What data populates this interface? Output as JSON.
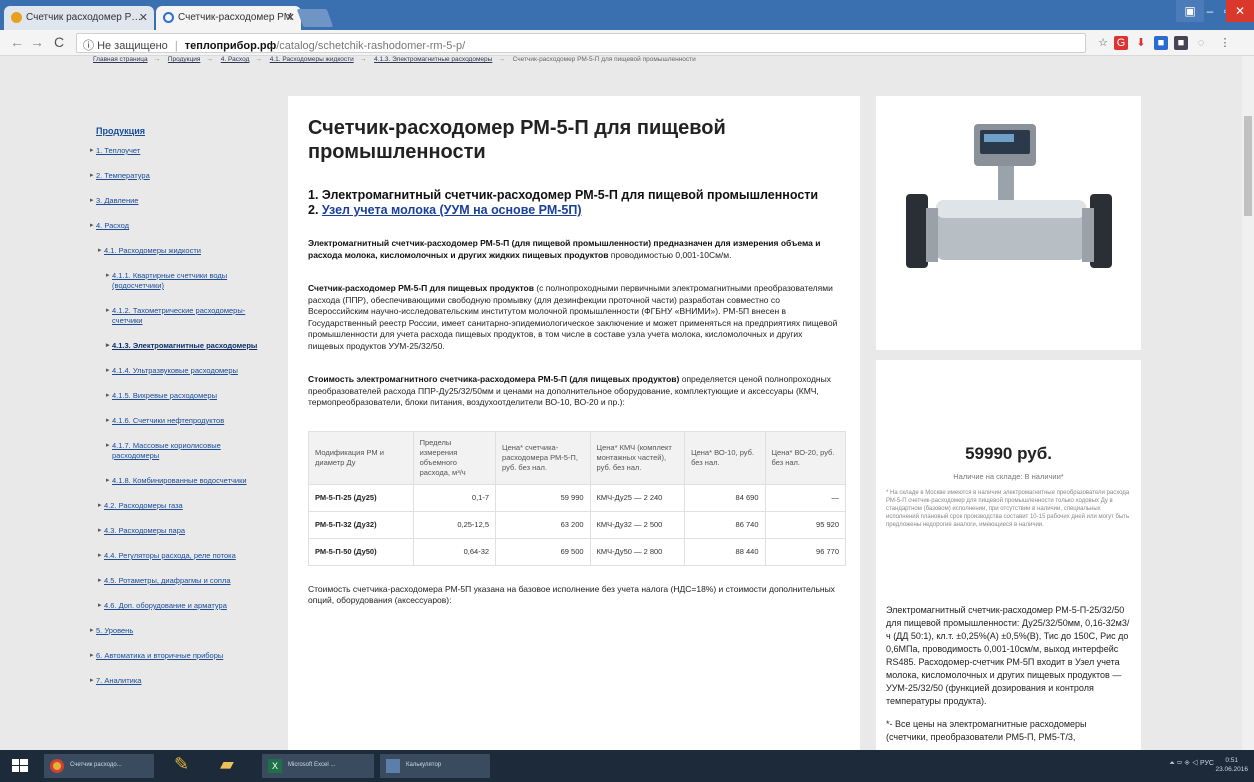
{
  "browser": {
    "tabs": [
      {
        "title": "Счетчик расходомер Р…",
        "active": false
      },
      {
        "title": "Счетчик-расходомер РМ",
        "active": true
      }
    ],
    "address": {
      "secure_label": "Не защищено",
      "host": "теплоприбор.рф",
      "path": "/catalog/schetchik-rashodomer-rm-5-p/"
    }
  },
  "breadcrumb": [
    "Главная страница",
    "Продукция",
    "4. Расход",
    "4.1. Расходомеры жидкости",
    "4.1.3. Электромагнитные расходомеры",
    "Счетчик-расходомер РМ-5-П для пищевой промышленности"
  ],
  "sidebar": {
    "heading": "Продукция",
    "items": [
      {
        "label": "1. Теплоучет",
        "level": 1
      },
      {
        "label": "2. Температура",
        "level": 1
      },
      {
        "label": "3. Давление",
        "level": 1
      },
      {
        "label": "4. Расход",
        "level": 1
      },
      {
        "label": "4.1. Расходомеры жидкости",
        "level": 2
      },
      {
        "label": "4.1.1. Квартирные счетчики воды (водосчетчики)",
        "level": 3
      },
      {
        "label": "4.1.2. Тахометрические расходомеры-счетчики",
        "level": 3
      },
      {
        "label": "4.1.3. Электромагнитные расходомеры",
        "level": 3,
        "active": true
      },
      {
        "label": "4.1.4. Ультразвуковые расходомеры",
        "level": 3
      },
      {
        "label": "4.1.5. Вихревые расходомеры",
        "level": 3
      },
      {
        "label": "4.1.6. Счетчики нефтепродуктов",
        "level": 3
      },
      {
        "label": "4.1.7. Массовые кориолисовые расходомеры",
        "level": 3
      },
      {
        "label": "4.1.8. Комбинированные водосчетчики",
        "level": 3
      },
      {
        "label": "4.2. Расходомеры газа",
        "level": 2
      },
      {
        "label": "4.3. Расходомеры пара",
        "level": 2
      },
      {
        "label": "4.4. Регуляторы расхода, реле потока",
        "level": 2
      },
      {
        "label": "4.5. Ротаметры, диафрагмы и сопла",
        "level": 2
      },
      {
        "label": "4.6. Доп. оборудование и арматура",
        "level": 2
      },
      {
        "label": "5. Уровень",
        "level": 1
      },
      {
        "label": "6. Автоматика и вторичные приборы",
        "level": 1
      },
      {
        "label": "7. Аналитика",
        "level": 1
      }
    ]
  },
  "main": {
    "title": "Счетчик-расходомер РМ-5-П для пищевой промышленности",
    "subtitle1": "1. Электромагнитный счетчик-расходомер РМ-5-П для пищевой промышленности",
    "subtitle2_prefix": "2. ",
    "subtitle2_link": "Узел учета молока (УУМ на основе РМ-5П)",
    "p1_bold": "Электромагнитный счетчик-расходомер РМ-5-П (для пищевой промышленности)  предназначен для измерения объема и расхода молока, кисломолочных и других жидких пищевых продуктов",
    "p1_rest": " проводимостью 0,001-10См/м.",
    "p2_bold": "Счетчик-расходомер РМ-5-П для пищевых продуктов",
    "p2_rest": " (с полнопроходными первичными электромагнитными преобразователями расхода (ППР), обеспечивающими свободную промывку (для дезинфекции проточной части) разработан совместно со Всероссийским научно-исследовательским институтом молочной промышленности (ФГБНУ «ВНИМИ»). РМ-5П внесен в Государственный реестр России, имеет санитарно-эпидемиологическое заключение и может применяться на предприятиях пищевой промышленности для учета расхода пищевых продуктов, в том числе в составе узла учета молока, кисломолочных и других пищевых продуктов УУМ-25/32/50.",
    "p3_bold": "Стоимость электромагнитного счетчика-расходомера РМ-5-П (для пищевых продуктов)",
    "p3_rest": " определяется ценой полнопроходных преобразователей расхода ППР-Ду25/32/50мм и ценами на дополнительное оборудование, комплектующие и аксессуары (КМЧ, термопреобразователи, блоки питания, воздухоотделители ВО-10, ВО-20 и пр.):",
    "table": {
      "headers": [
        "Модификация РМ и диаметр Ду",
        "Пределы измерения объемного расхода, м³/ч",
        "Цена* счетчика-расходомера РМ-5-П, руб. без нал.",
        "Цена* КМЧ (комплект монтажных частей), руб. без нал.",
        "Цена* ВО-10, руб. без нал.",
        "Цена* ВО-20, руб. без нал."
      ],
      "rows": [
        [
          "РМ-5-П-25 (Ду25)",
          "0,1-7",
          "59 990",
          "КМЧ-Ду25 — 2 240",
          "84 690",
          "—"
        ],
        [
          "РМ-5-П-32 (Ду32)",
          "0,25-12,5",
          "63 200",
          "КМЧ-Ду32 — 2 500",
          "86 740",
          "95 920"
        ],
        [
          "РМ-5-П-50 (Ду50)",
          "0,64-32",
          "69 500",
          "КМЧ-Ду50 — 2 800",
          "88 440",
          "96 770"
        ]
      ]
    },
    "bottom_note": "Стоимость счетчика-расходомера РМ-5П указана на базовое исполнение без учета налога (НДС=18%) и стоимости дополнительных опций, оборудования (аксессуаров):"
  },
  "right": {
    "price": "59990 руб.",
    "stock": "Наличие на складе: В наличии*",
    "stock_note": "* На складе в Москве имеются в наличии электромагнитные преобразователи расхода РМ-5-П счетчик-расходомер для пищевой промышленности только ходовых Ду в стандартном (базовом) исполнении, при отсутствии в наличии, специальных исполнений плановый срок производства составит 10-15 рабочих дней или могут быть предложены недорогие аналоги, имеющиеся в наличии.",
    "desc": "Электромагнитный счетчик-расходомер РМ-5-П-25/32/50 для пищевой промышленности: Ду25/32/50мм, 0,16-32м3/ч (ДД 50:1), кл.т. ±0,25%(А) ±0,5%(В), Тис до 150С, Рис до 0,6МПа, проводимость 0,001-10см/м, выход интерфейс RS485. Расходомер-счетчик РМ-5П входит в Узел учета молока, кисломолочных и других пищевых продуктов — УУМ-25/32/50 (функцией дозирования и контроля температуры продукта).",
    "desc2": "*- Все цены на электромагнитные расходомеры (счетчики, преобразователи РМ5-П, РМ5-Т/3,"
  },
  "taskbar": {
    "items": [
      "Счетчик расходо...",
      "Microsoft Excel ...",
      "Калькулятор"
    ],
    "tray": "РУС",
    "time": "0:51",
    "date": "23.06.2016"
  }
}
